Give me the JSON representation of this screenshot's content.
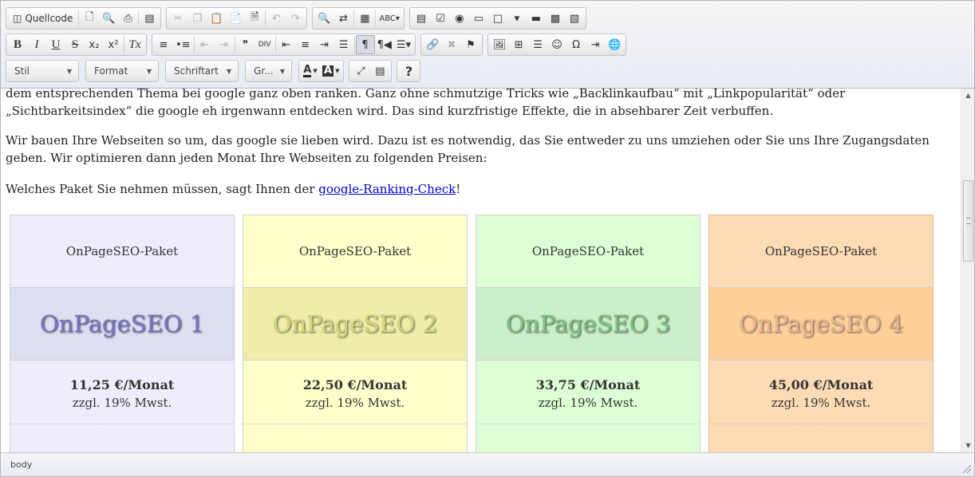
{
  "toolbar": {
    "row1": {
      "source_label": "Quellcode",
      "icons": [
        "new-page-icon",
        "preview-icon",
        "print-icon",
        "templates-icon",
        "cut-icon",
        "copy-icon",
        "paste-icon",
        "paste-text-icon",
        "paste-word-icon",
        "undo-icon",
        "redo-icon",
        "find-icon",
        "replace-icon",
        "select-all-icon",
        "spellcheck-icon",
        "form-icon",
        "checkbox-icon",
        "radio-icon",
        "textfield-icon",
        "textarea-icon",
        "select-icon",
        "button-icon",
        "image-button-icon",
        "hidden-field-icon"
      ]
    },
    "row2": {
      "bold": "B",
      "italic": "I",
      "underline": "U",
      "strike": "S",
      "subscript": "x₂",
      "superscript": "x²",
      "remove_format": "Tx",
      "blockquote": "❞",
      "creatediv": "DIV",
      "help": "?"
    },
    "row3": {
      "style": "Stil",
      "format": "Format",
      "font": "Schriftart",
      "size": "Gr...",
      "text_color": "A",
      "bg_color": "A",
      "help": "?"
    }
  },
  "content": {
    "p1": "dem entsprechenden Thema bei google ganz oben ranken. Ganz ohne schmutzige Tricks wie „Backlinkaufbau“ mit „Linkpopularität“ oder „Sichtbarkeitsindex“ die google eh irgenwann entdecken wird. Das sind kurzfristige Effekte, die in absehbarer Zeit verbuffen.",
    "p2": "Wir bauen Ihre Webseiten so um, das google sie lieben wird. Dazu ist es notwendig, das Sie entweder zu uns umziehen oder Sie uns Ihre Zugangsdaten geben. Wir optimieren dann jeden Monat Ihre Webseiten zu folgenden Preisen:",
    "p3_before": "Welches Paket Sie nehmen müssen, sagt Ihnen der ",
    "p3_link": "google-Ranking-Check",
    "p3_after": "!"
  },
  "packages": [
    {
      "header": "OnPageSEO-Paket",
      "title": "OnPageSEO 1",
      "price": "11,25 €/Monat",
      "vat": "zzgl. 19% Mwst."
    },
    {
      "header": "OnPageSEO-Paket",
      "title": "OnPageSEO 2",
      "price": "22,50 €/Monat",
      "vat": "zzgl. 19% Mwst."
    },
    {
      "header": "OnPageSEO-Paket",
      "title": "OnPageSEO 3",
      "price": "33,75 €/Monat",
      "vat": "zzgl. 19% Mwst."
    },
    {
      "header": "OnPageSEO-Paket",
      "title": "OnPageSEO 4",
      "price": "45,00 €/Monat",
      "vat": "zzgl. 19% Mwst."
    }
  ],
  "statusbar": {
    "path": "body"
  }
}
